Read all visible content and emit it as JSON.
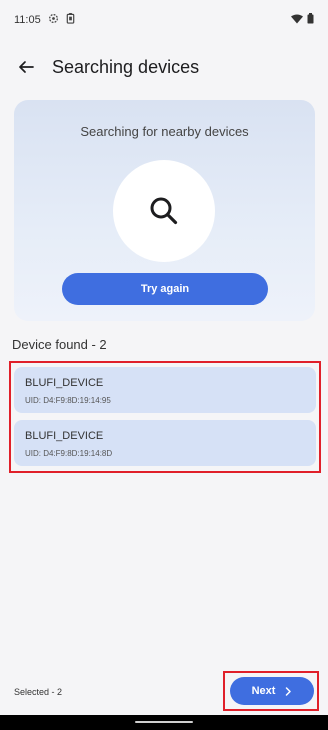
{
  "status_bar": {
    "time": "11:05",
    "icons": [
      "settings-icon",
      "battery-saver-icon",
      "wifi-icon",
      "battery-icon"
    ]
  },
  "app_bar": {
    "back_icon": "arrow-left-icon",
    "title": "Searching devices"
  },
  "search_card": {
    "message": "Searching for nearby devices",
    "icon": "search-icon",
    "try_again_label": "Try again"
  },
  "devices": {
    "found_label": "Device found - 2",
    "items": [
      {
        "name": "BLUFI_DEVICE",
        "uid": "UID: D4:F9:8D:19:14:95"
      },
      {
        "name": "BLUFI_DEVICE",
        "uid": "UID: D4:F9:8D:19:14:8D"
      }
    ]
  },
  "footer": {
    "selected_label": "Selected - 2",
    "next_label": "Next",
    "next_icon": "chevron-right-icon"
  },
  "colors": {
    "accent": "#3f6ee0",
    "highlight_border": "#e0202a",
    "device_bg": "#d6e1f6"
  }
}
